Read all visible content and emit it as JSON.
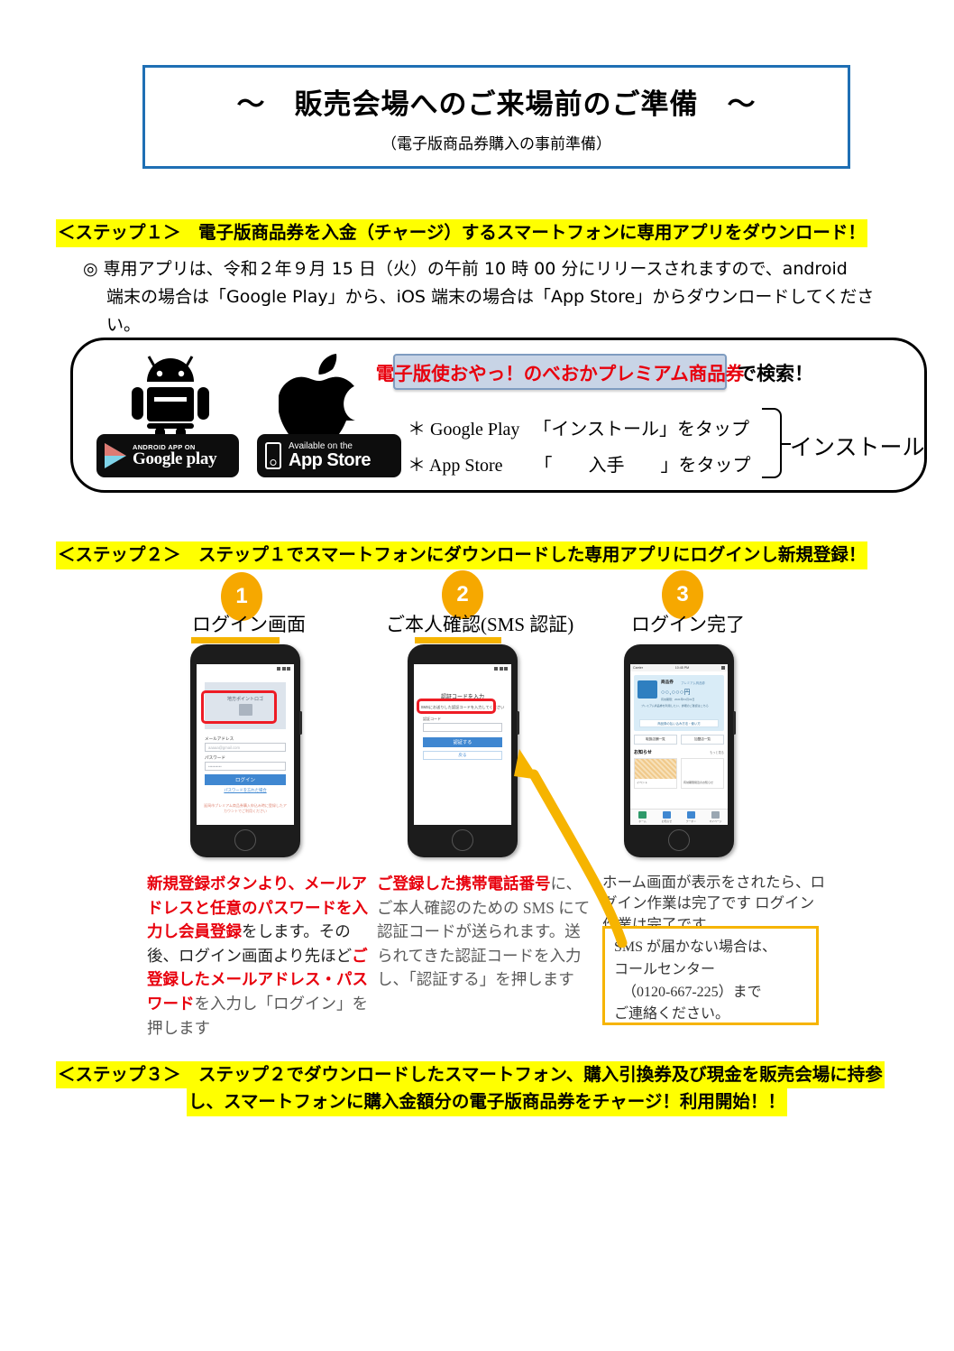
{
  "title": {
    "main": "～　販売会場へのご来場前のご準備　～",
    "sub": "（電子版商品券購入の事前準備）",
    "border_color": "#1f6fb4"
  },
  "step1": {
    "heading": "＜ステップ１＞　電子版商品券を入金（チャージ）するスマートフォンに専用アプリをダウンロード！",
    "body_line1": "◎ 専用アプリは、令和２年９月 15 日（火）の午前 10 時 00 分にリリースされますので、android",
    "body_line2": "端末の場合は「Google Play」から、iOS 端末の場合は「App Store」からダウンロードしてくださ",
    "body_line3": "い。",
    "download_box": {
      "android_icon": "android-robot-icon",
      "apple_icon": "apple-logo-icon",
      "google_play_badge": {
        "small_text": "ANDROID APP ON",
        "big_text": "Google play"
      },
      "app_store_badge": {
        "small_text": "Available on the",
        "big_text": "App Store"
      },
      "search_pill_text": "電子版使おやっ！のべおかプレミアム商品券",
      "search_pill_bg": "#c8d4e6",
      "search_pill_text_color": "#e8000d",
      "search_suffix": "で検索！",
      "tap_line1": "＊ Google Play 　「インストール」をタップ",
      "tap_line2": "＊ App Store 　　「　　入手　　」をタップ",
      "install_word": "インストール"
    }
  },
  "step2": {
    "heading": "＜ステップ２＞　ステップ１でスマートフォンにダウンロードした専用アプリにログインし新規登録！",
    "phones": [
      {
        "number": "1",
        "label": "ログイン画面",
        "screen": {
          "logo_text": "地方ポイントロゴ",
          "email_label": "メールアドレス",
          "email_placeholder": "aaaaa@gmail.com",
          "password_label": "パスワード",
          "password_value": "••••••••••",
          "login_button": "ログイン",
          "forgot_link": "パスワードを忘れた場合",
          "note": "延岡市プレミアム商品券購入申込み時に登録したアカウントでご利用ください"
        },
        "caption_parts": [
          {
            "text": "新規登録ボタンより、メールアドレスと任意のパスワードを入力し会員登録",
            "color": "red"
          },
          {
            "text": "をします。その後、ログイン画面より先ほど",
            "color": "black"
          },
          {
            "text": "ご登録したメールアドレス・パスワード",
            "color": "red"
          },
          {
            "text": "を入力し「ログイン」を押します",
            "color": "gray"
          }
        ]
      },
      {
        "number": "2",
        "label": "ご本人確認(SMS 認証)",
        "screen": {
          "title": "認証コードを入力",
          "sub": "SMSにお送りした認証コードを入力してください",
          "field_label": "認証コード",
          "primary_button": "認証する",
          "secondary_button": "戻る"
        },
        "caption_parts": [
          {
            "text": "ご登録した携帯電話番号",
            "color": "red"
          },
          {
            "text": "に、ご本人確認のための SMS にて認証コードが送られます。送られてきた認証コードを入力し、「認証する」を押します",
            "color": "gray"
          }
        ]
      },
      {
        "number": "3",
        "label": "ログイン完了",
        "screen": {
          "status_left": "Carrier",
          "status_center": "10:45 PM",
          "card_title": "商品券",
          "card_tag": "プレミアム商品券",
          "card_amount": "○○,○○○円",
          "card_small": "有効期限：2021年01月31日",
          "card_desc": "プレミアム商品券を利用したい、詳細のご確認はこちら",
          "card_bar": "商品券の払い込み方法・使い方",
          "button1": "取扱店舗一覧",
          "button2": "加盟店一覧",
          "news_title": "お知らせ",
          "news_more": "もっと見る",
          "tile1_caption": "イベント",
          "tile2_caption": "有効期限間近のお知らせ",
          "tabs": [
            "ホーム",
            "お知らせ",
            "クーポン",
            "マイページ"
          ]
        },
        "caption_parts": [
          {
            "text": "ホーム画面が表示をされたら、ログイン作業は完了です ログイン作業は完了です",
            "color": "gray"
          }
        ]
      }
    ],
    "sms_callout": {
      "line1": "SMS が届かない場合は、",
      "line2": "コールセンター",
      "line3": "（0120-667-225）まで",
      "line4": "ご連絡ください。",
      "border_color": "#f6b400"
    },
    "arrow_color": "#f6b400"
  },
  "step3": {
    "line1": "＜ステップ３＞　ステップ２でダウンロードしたスマートフォン、購入引換券及び現金を販売会場に持参",
    "line2": "し、スマートフォンに購入金額分の電子版商品券をチャージ！利用開始！！"
  },
  "colors": {
    "highlight": "#ffff00",
    "accent_orange": "#f6a800",
    "accent_red": "#e8000d",
    "accent_blue": "#1f6fb4"
  }
}
